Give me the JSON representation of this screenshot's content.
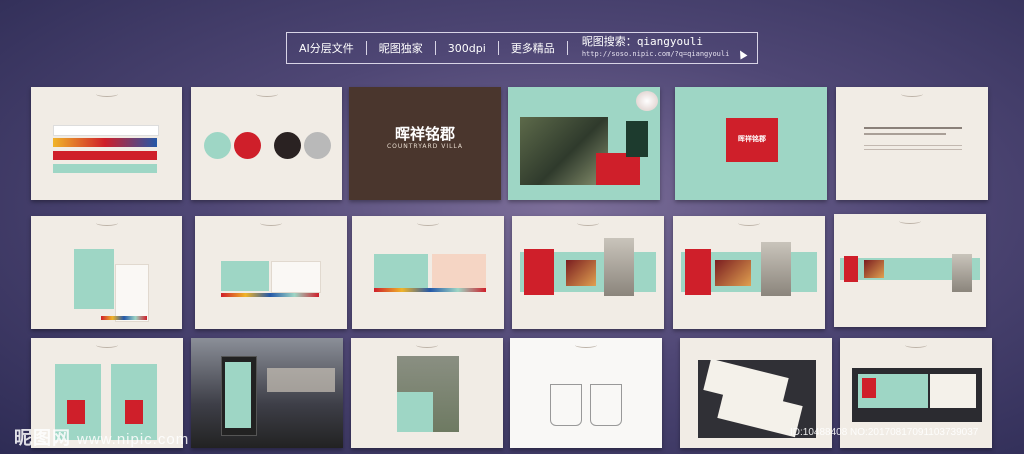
{
  "banner": {
    "item1": "AI分层文件",
    "item2": "昵图独家",
    "item3": "300dpi",
    "item4": "更多精品",
    "search_label": "昵图搜索：",
    "search_query": "qiangyouli",
    "search_url": "http://soso.nipic.com/?q=qiangyouli"
  },
  "boards": {
    "brand_name": "晖祥铭郡",
    "brand_en": "COUNTRYARD VILLA"
  },
  "watermark": {
    "site": "昵图网",
    "url": "www.nipic.com"
  },
  "id_tag": "ID:10488408 NO:20170817091103739037",
  "colors": {
    "mint": "#9ed6c5",
    "red": "#cf1f2a",
    "brown": "#4a362d",
    "paper": "#f1ece5"
  }
}
